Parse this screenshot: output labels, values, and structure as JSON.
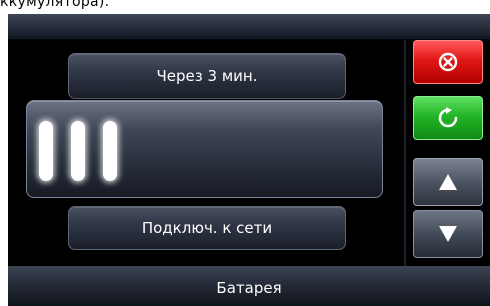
{
  "caption_fragment": "ккумулятора).",
  "panels": {
    "top_label": "Через 3 мин.",
    "main_level_bars": 3,
    "bottom_label": "Подключ. к сети"
  },
  "side_buttons": {
    "cancel_icon": "close-circle-icon",
    "refresh_icon": "refresh-icon",
    "up_icon": "arrow-up-icon",
    "down_icon": "arrow-down-icon"
  },
  "footer": {
    "title": "Батарея"
  },
  "colors": {
    "cancel": "#e21717",
    "refresh": "#22b526",
    "panel": "#303746",
    "screen_bg": "#000000"
  }
}
